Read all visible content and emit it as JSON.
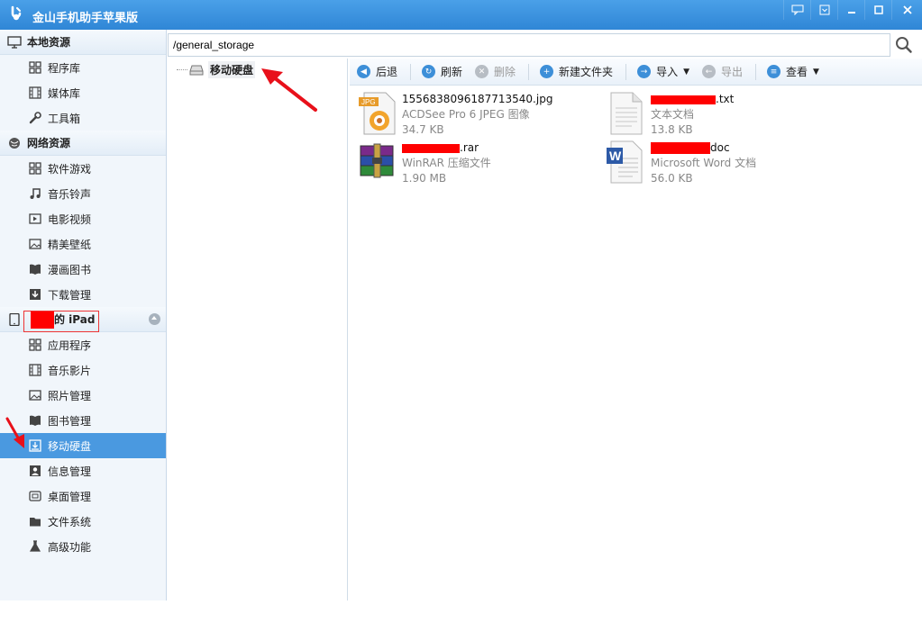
{
  "app": {
    "title": "金山手机助手苹果版"
  },
  "window_buttons": [
    {
      "name": "feedback-button",
      "glyph": "💬"
    },
    {
      "name": "menu-button",
      "glyph": "▣"
    },
    {
      "name": "minimize-button",
      "glyph": "—"
    },
    {
      "name": "maximize-button",
      "glyph": "□"
    },
    {
      "name": "close-button",
      "glyph": "✕"
    }
  ],
  "sidebar": {
    "local": {
      "header": "本地资源",
      "items": [
        {
          "label": "程序库",
          "icon": "grid-icon"
        },
        {
          "label": "媒体库",
          "icon": "film-icon"
        },
        {
          "label": "工具箱",
          "icon": "wrench-icon"
        }
      ]
    },
    "network": {
      "header": "网络资源",
      "items": [
        {
          "label": "软件游戏",
          "icon": "grid-icon"
        },
        {
          "label": "音乐铃声",
          "icon": "music-icon"
        },
        {
          "label": "电影视频",
          "icon": "video-icon"
        },
        {
          "label": "精美壁纸",
          "icon": "picture-icon"
        },
        {
          "label": "漫画图书",
          "icon": "book-icon"
        },
        {
          "label": "下载管理",
          "icon": "download-icon"
        }
      ]
    },
    "device": {
      "header_suffix": "的 iPad",
      "items": [
        {
          "label": "应用程序",
          "icon": "grid-icon"
        },
        {
          "label": "音乐影片",
          "icon": "film-icon"
        },
        {
          "label": "照片管理",
          "icon": "picture-icon"
        },
        {
          "label": "图书管理",
          "icon": "book-icon"
        },
        {
          "label": "移动硬盘",
          "icon": "usb-disk-icon",
          "active": true
        },
        {
          "label": "信息管理",
          "icon": "contact-icon"
        },
        {
          "label": "桌面管理",
          "icon": "desktop-icon"
        },
        {
          "label": "文件系统",
          "icon": "folder-icon"
        },
        {
          "label": "高级功能",
          "icon": "flask-icon"
        }
      ]
    }
  },
  "path": {
    "value": "/general_storage"
  },
  "tree": {
    "root_label": "移动硬盘"
  },
  "toolbar": {
    "back": "后退",
    "refresh": "刷新",
    "delete": "删除",
    "new_folder": "新建文件夹",
    "import": "导入",
    "export": "导出",
    "view": "查看"
  },
  "files": [
    {
      "name": "1556838096187713540.jpg",
      "type": "ACDSee Pro 6 JPEG 图像",
      "size": "34.7 KB",
      "icon": "jpg-file-icon"
    },
    {
      "name": ".txt",
      "type": "文本文档",
      "size": "13.8 KB",
      "icon": "txt-file-icon",
      "redacted": true
    },
    {
      "name": ".rar",
      "type": "WinRAR 压缩文件",
      "size": "1.90 MB",
      "icon": "rar-file-icon",
      "redacted": true
    },
    {
      "name": "doc",
      "type": "Microsoft Word 文档",
      "size": "56.0 KB",
      "icon": "word-file-icon",
      "redacted": true
    }
  ]
}
